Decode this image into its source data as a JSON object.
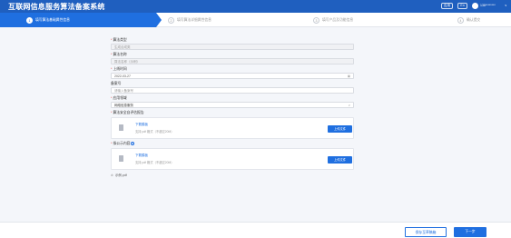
{
  "header": {
    "title": "互联网信息服务算法备案系统",
    "btn_1": "应用",
    "btn_2": "En",
    "user": "138********",
    "caret": "∨"
  },
  "steps": [
    {
      "num": "1",
      "label": "填写算法基础属性信息",
      "active": true
    },
    {
      "num": "2",
      "label": "填写算法详细属性信息",
      "active": false
    },
    {
      "num": "3",
      "label": "填写产品及功能信息",
      "active": false
    },
    {
      "num": "4",
      "label": "确认提交",
      "active": false
    }
  ],
  "form": {
    "algo_type": {
      "label": "算法类型",
      "value": "生成合成类"
    },
    "algo_name": {
      "label": "算法名称",
      "value": "算法名称（示例）"
    },
    "online_time": {
      "label": "上线时间",
      "value": "2022-03-27"
    },
    "filing_no": {
      "label": "备案号",
      "placeholder": "请输入备案号"
    },
    "app_field": {
      "label": "应用领域",
      "value": "网络信息服务"
    },
    "self_assess": {
      "label": "算法安全自评估报告",
      "template_link": "下载模板",
      "hint": "支持 pdf 格式（不超过20M）",
      "upload_label": "上传文件"
    },
    "disclosure": {
      "label": "拟公示内容",
      "template_link": "下载模板",
      "hint": "支持 pdf 格式（不超过20M）",
      "upload_label": "上传文件",
      "attached": "示例.pdf"
    }
  },
  "footer": {
    "save_label": "保存至草稿箱",
    "next_label": "下一步"
  },
  "colors": {
    "primary": "#1f6fe0",
    "header_bg": "#1f5fbf",
    "required": "#e54545"
  }
}
